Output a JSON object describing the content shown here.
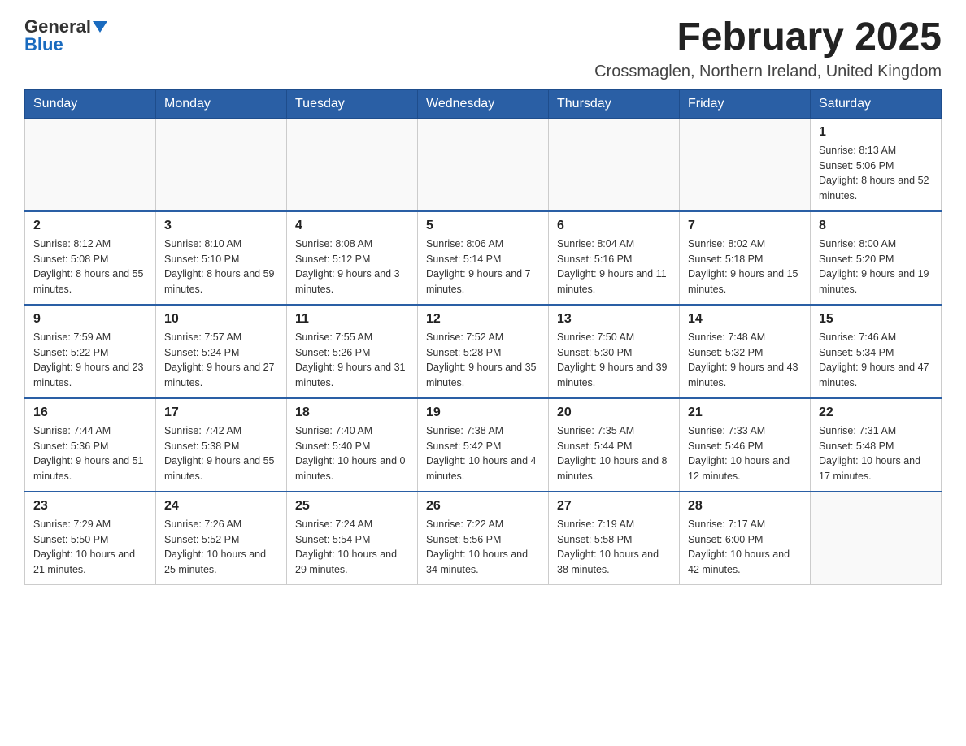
{
  "logo": {
    "general": "General",
    "blue": "Blue"
  },
  "header": {
    "month": "February 2025",
    "location": "Crossmaglen, Northern Ireland, United Kingdom"
  },
  "weekdays": [
    "Sunday",
    "Monday",
    "Tuesday",
    "Wednesday",
    "Thursday",
    "Friday",
    "Saturday"
  ],
  "weeks": [
    [
      {
        "day": "",
        "info": ""
      },
      {
        "day": "",
        "info": ""
      },
      {
        "day": "",
        "info": ""
      },
      {
        "day": "",
        "info": ""
      },
      {
        "day": "",
        "info": ""
      },
      {
        "day": "",
        "info": ""
      },
      {
        "day": "1",
        "info": "Sunrise: 8:13 AM\nSunset: 5:06 PM\nDaylight: 8 hours and 52 minutes."
      }
    ],
    [
      {
        "day": "2",
        "info": "Sunrise: 8:12 AM\nSunset: 5:08 PM\nDaylight: 8 hours and 55 minutes."
      },
      {
        "day": "3",
        "info": "Sunrise: 8:10 AM\nSunset: 5:10 PM\nDaylight: 8 hours and 59 minutes."
      },
      {
        "day": "4",
        "info": "Sunrise: 8:08 AM\nSunset: 5:12 PM\nDaylight: 9 hours and 3 minutes."
      },
      {
        "day": "5",
        "info": "Sunrise: 8:06 AM\nSunset: 5:14 PM\nDaylight: 9 hours and 7 minutes."
      },
      {
        "day": "6",
        "info": "Sunrise: 8:04 AM\nSunset: 5:16 PM\nDaylight: 9 hours and 11 minutes."
      },
      {
        "day": "7",
        "info": "Sunrise: 8:02 AM\nSunset: 5:18 PM\nDaylight: 9 hours and 15 minutes."
      },
      {
        "day": "8",
        "info": "Sunrise: 8:00 AM\nSunset: 5:20 PM\nDaylight: 9 hours and 19 minutes."
      }
    ],
    [
      {
        "day": "9",
        "info": "Sunrise: 7:59 AM\nSunset: 5:22 PM\nDaylight: 9 hours and 23 minutes."
      },
      {
        "day": "10",
        "info": "Sunrise: 7:57 AM\nSunset: 5:24 PM\nDaylight: 9 hours and 27 minutes."
      },
      {
        "day": "11",
        "info": "Sunrise: 7:55 AM\nSunset: 5:26 PM\nDaylight: 9 hours and 31 minutes."
      },
      {
        "day": "12",
        "info": "Sunrise: 7:52 AM\nSunset: 5:28 PM\nDaylight: 9 hours and 35 minutes."
      },
      {
        "day": "13",
        "info": "Sunrise: 7:50 AM\nSunset: 5:30 PM\nDaylight: 9 hours and 39 minutes."
      },
      {
        "day": "14",
        "info": "Sunrise: 7:48 AM\nSunset: 5:32 PM\nDaylight: 9 hours and 43 minutes."
      },
      {
        "day": "15",
        "info": "Sunrise: 7:46 AM\nSunset: 5:34 PM\nDaylight: 9 hours and 47 minutes."
      }
    ],
    [
      {
        "day": "16",
        "info": "Sunrise: 7:44 AM\nSunset: 5:36 PM\nDaylight: 9 hours and 51 minutes."
      },
      {
        "day": "17",
        "info": "Sunrise: 7:42 AM\nSunset: 5:38 PM\nDaylight: 9 hours and 55 minutes."
      },
      {
        "day": "18",
        "info": "Sunrise: 7:40 AM\nSunset: 5:40 PM\nDaylight: 10 hours and 0 minutes."
      },
      {
        "day": "19",
        "info": "Sunrise: 7:38 AM\nSunset: 5:42 PM\nDaylight: 10 hours and 4 minutes."
      },
      {
        "day": "20",
        "info": "Sunrise: 7:35 AM\nSunset: 5:44 PM\nDaylight: 10 hours and 8 minutes."
      },
      {
        "day": "21",
        "info": "Sunrise: 7:33 AM\nSunset: 5:46 PM\nDaylight: 10 hours and 12 minutes."
      },
      {
        "day": "22",
        "info": "Sunrise: 7:31 AM\nSunset: 5:48 PM\nDaylight: 10 hours and 17 minutes."
      }
    ],
    [
      {
        "day": "23",
        "info": "Sunrise: 7:29 AM\nSunset: 5:50 PM\nDaylight: 10 hours and 21 minutes."
      },
      {
        "day": "24",
        "info": "Sunrise: 7:26 AM\nSunset: 5:52 PM\nDaylight: 10 hours and 25 minutes."
      },
      {
        "day": "25",
        "info": "Sunrise: 7:24 AM\nSunset: 5:54 PM\nDaylight: 10 hours and 29 minutes."
      },
      {
        "day": "26",
        "info": "Sunrise: 7:22 AM\nSunset: 5:56 PM\nDaylight: 10 hours and 34 minutes."
      },
      {
        "day": "27",
        "info": "Sunrise: 7:19 AM\nSunset: 5:58 PM\nDaylight: 10 hours and 38 minutes."
      },
      {
        "day": "28",
        "info": "Sunrise: 7:17 AM\nSunset: 6:00 PM\nDaylight: 10 hours and 42 minutes."
      },
      {
        "day": "",
        "info": ""
      }
    ]
  ]
}
